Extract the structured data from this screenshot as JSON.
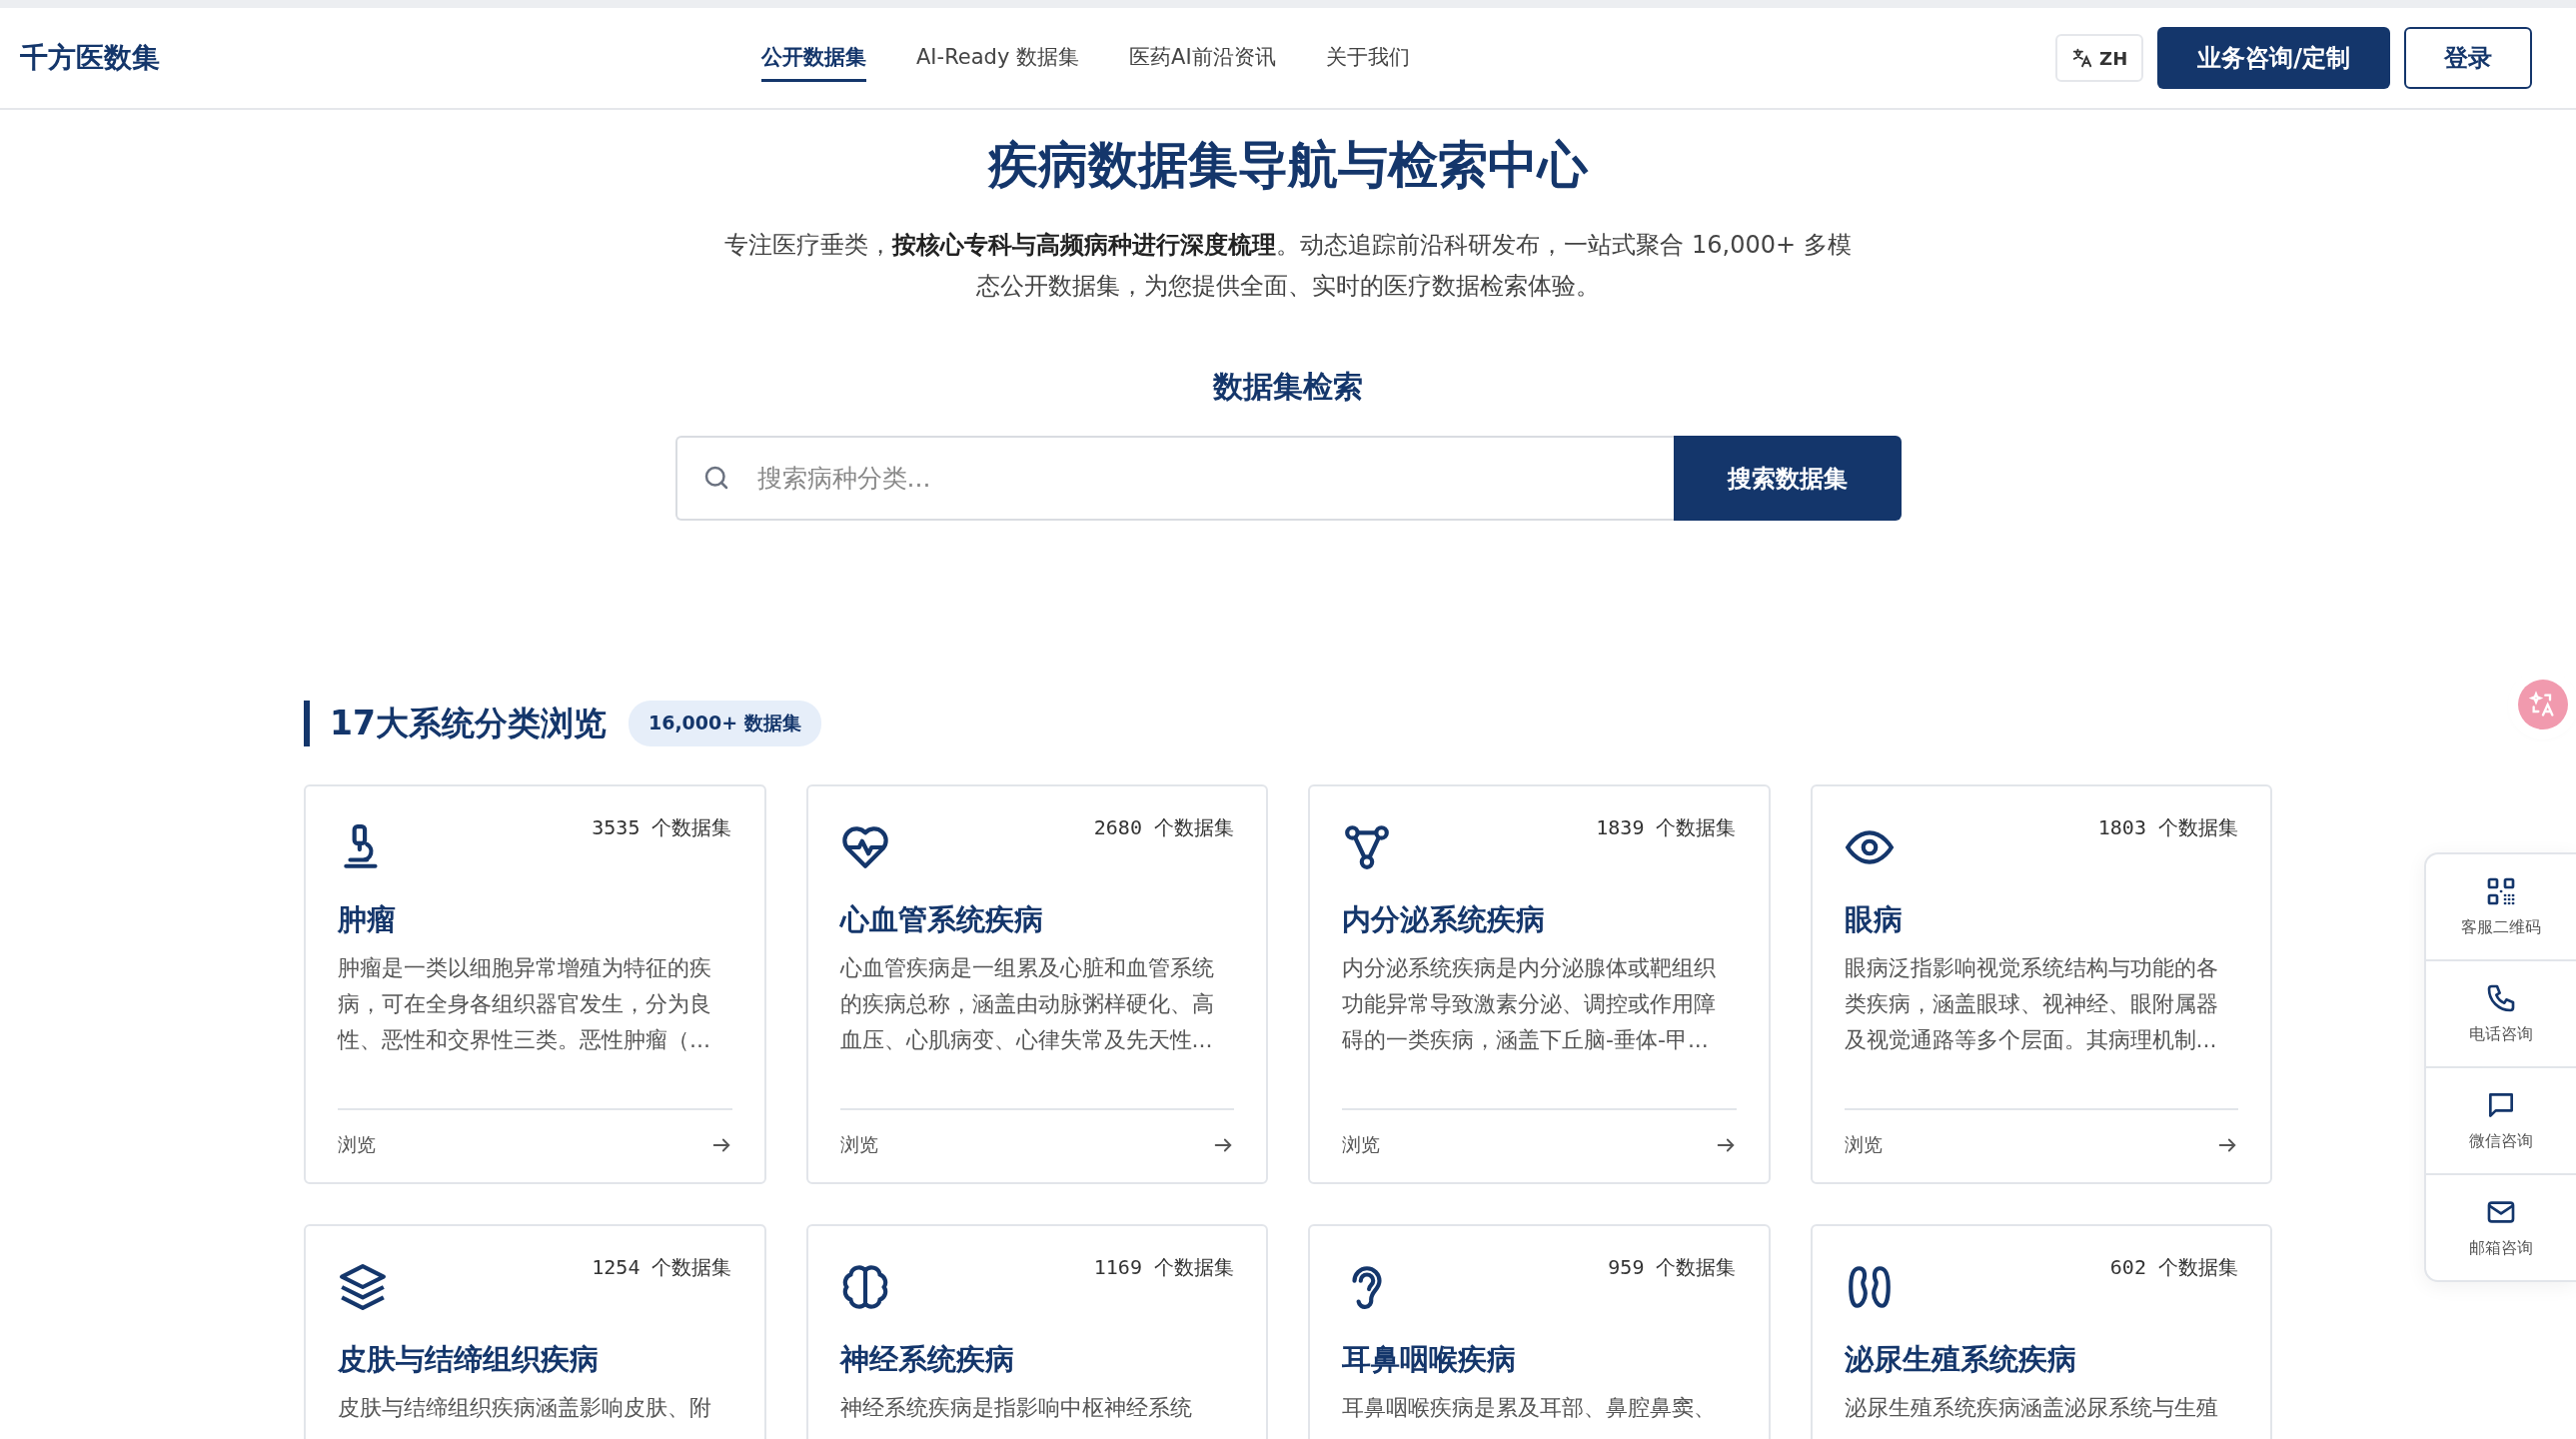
{
  "header": {
    "logo": "千方医数集",
    "nav": [
      {
        "label": "公开数据集",
        "selected": true
      },
      {
        "label": "AI-Ready 数据集",
        "selected": false
      },
      {
        "label": "医药AI前沿资讯",
        "selected": false
      },
      {
        "label": "关于我们",
        "selected": false
      }
    ],
    "language": "ZH",
    "consult_button": "业务咨询/定制",
    "login_button": "登录"
  },
  "hero": {
    "title": "疾病数据集导航与检索中心",
    "intro": "专注医疗垂类，**按核心专科与高频病种进行深度梳理**。动态追踪前沿科研发布，一站式聚合 16,000+ 多模态公开数据集，为您提供全面、实时的医疗数据检索体验。"
  },
  "search": {
    "heading": "数据集检索",
    "placeholder": "搜索病种分类...",
    "button": "搜索数据集"
  },
  "categories": {
    "title": "17大系统分类浏览",
    "badge": "16,000+ 数据集",
    "cards": [
      {
        "kind": "microscope",
        "count": "3535",
        "unit": "个数据集",
        "name": "肿瘤",
        "description": "肿瘤是一类以细胞异常增殖为特征的疾病，可在全身各组织器官发生，分为良性、恶性和交界性三类。恶性肿瘤（...",
        "link": "浏览"
      },
      {
        "kind": "heart",
        "count": "2680",
        "unit": "个数据集",
        "name": "心血管系统疾病",
        "description": "心血管疾病是一组累及心脏和血管系统的疾病总称，涵盖由动脉粥样硬化、高血压、心肌病变、心律失常及先天性...",
        "link": "浏览"
      },
      {
        "kind": "nodes",
        "count": "1839",
        "unit": "个数据集",
        "name": "内分泌系统疾病",
        "description": "内分泌系统疾病是内分泌腺体或靶组织功能异常导致激素分泌、调控或作用障碍的一类疾病，涵盖下丘脑-垂体-甲...",
        "link": "浏览"
      },
      {
        "kind": "eye",
        "count": "1803",
        "unit": "个数据集",
        "name": "眼病",
        "description": "眼病泛指影响视觉系统结构与功能的各类疾病，涵盖眼球、视神经、眼附属器及视觉通路等多个层面。其病理机制...",
        "link": "浏览"
      },
      {
        "kind": "layers",
        "count": "1254",
        "unit": "个数据集",
        "name": "皮肤与结缔组织疾病",
        "description": "皮肤与结缔组织疾病涵盖影响皮肤、附"
      },
      {
        "kind": "brain",
        "count": "1169",
        "unit": "个数据集",
        "name": "神经系统疾病",
        "description": "神经系统疾病是指影响中枢神经系统"
      },
      {
        "kind": "ear",
        "count": "959",
        "unit": "个数据集",
        "name": "耳鼻咽喉疾病",
        "description": "耳鼻咽喉疾病是累及耳部、鼻腔鼻窦、"
      },
      {
        "kind": "kidney",
        "count": "602",
        "unit": "个数据集",
        "name": "泌尿生殖系统疾病",
        "description": "泌尿生殖系统疾病涵盖泌尿系统与生殖"
      }
    ]
  },
  "contact_bar": [
    {
      "kind": "qr",
      "label": "客服二维码"
    },
    {
      "kind": "phone",
      "label": "电话咨询"
    },
    {
      "kind": "chat",
      "label": "微信咨询"
    },
    {
      "kind": "mail",
      "label": "邮箱咨询"
    }
  ]
}
